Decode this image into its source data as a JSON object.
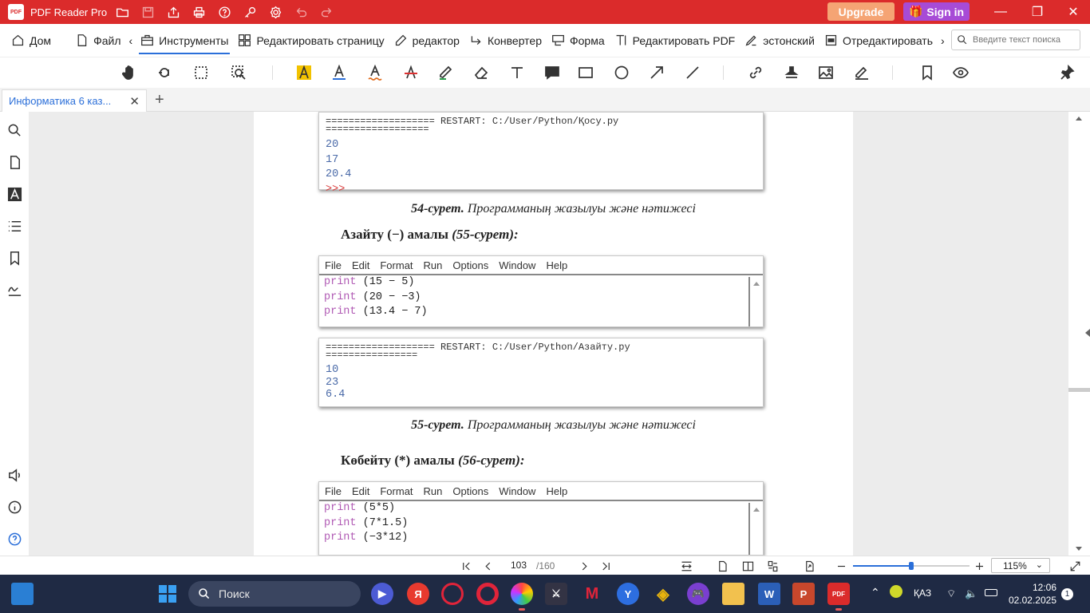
{
  "app": {
    "name": "PDF Reader Pro",
    "logo_text": "PDF",
    "upgrade_label": "Upgrade",
    "signin_label": "Sign in",
    "accent": "#db2b2b"
  },
  "menu": {
    "items": [
      {
        "label": "Дом",
        "icon": "home-icon"
      },
      {
        "label": "Файл",
        "icon": "file-icon"
      },
      {
        "label": "Инструменты",
        "icon": "toolbox-icon",
        "active": true
      },
      {
        "label": "Редактировать страницу",
        "icon": "grid-icon"
      },
      {
        "label": "редактор",
        "icon": "edit-icon"
      },
      {
        "label": "Конвертер",
        "icon": "convert-icon"
      },
      {
        "label": "Форма",
        "icon": "form-icon"
      },
      {
        "label": "Редактировать PDF",
        "icon": "text-edit-icon"
      },
      {
        "label": "эстонский",
        "icon": "sign-icon"
      },
      {
        "label": "Отредактировать",
        "icon": "redact-icon"
      }
    ],
    "search_placeholder": "Введите текст поиска"
  },
  "tabs": {
    "doc_title": "Информатика 6 каз..."
  },
  "document": {
    "block1": {
      "restart_line1": "=================== RESTART: C:/User/Python/Қосу.py",
      "restart_line2": "==================",
      "outputs": [
        "20",
        "17",
        "20.4"
      ],
      "prompt": ">>>"
    },
    "caption1_num": "54-сурет.",
    "caption1_text": "Программаның жазылуы және нәтижесі",
    "heading1_main": "Азайту (−) амалы",
    "heading1_ref": "(55-сурет):",
    "idle_menu": [
      "File",
      "Edit",
      "Format",
      "Run",
      "Options",
      "Window",
      "Help"
    ],
    "code1": [
      {
        "kw": "print",
        "rest": " (15 − 5)"
      },
      {
        "kw": "print",
        "rest": " (20 − −3)"
      },
      {
        "kw": "print",
        "rest": " (13.4 − 7)"
      }
    ],
    "block2": {
      "restart_line1": "=================== RESTART: C:/User/Python/Азайту.py",
      "restart_line2": "================",
      "outputs": [
        "10",
        "23",
        "6.4"
      ]
    },
    "caption2_num": "55-сурет.",
    "caption2_text": "Программаның жазылуы және нәтижесі",
    "heading2_main": "Көбейту (*) амалы",
    "heading2_ref": "(56-сурет):",
    "code2": [
      {
        "kw": "print",
        "rest": " (5*5)"
      },
      {
        "kw": "print",
        "rest": " (7*1.5)"
      },
      {
        "kw": "print",
        "rest": " (−3*12)"
      }
    ]
  },
  "status": {
    "page_current": "103",
    "page_total": "/160",
    "zoom": "115%",
    "zoom_fraction": 0.5
  },
  "taskbar": {
    "search_label": "Поиск",
    "lang": "ҚАЗ",
    "time": "12:06",
    "date": "02.02.2025",
    "notif_count": "1"
  }
}
